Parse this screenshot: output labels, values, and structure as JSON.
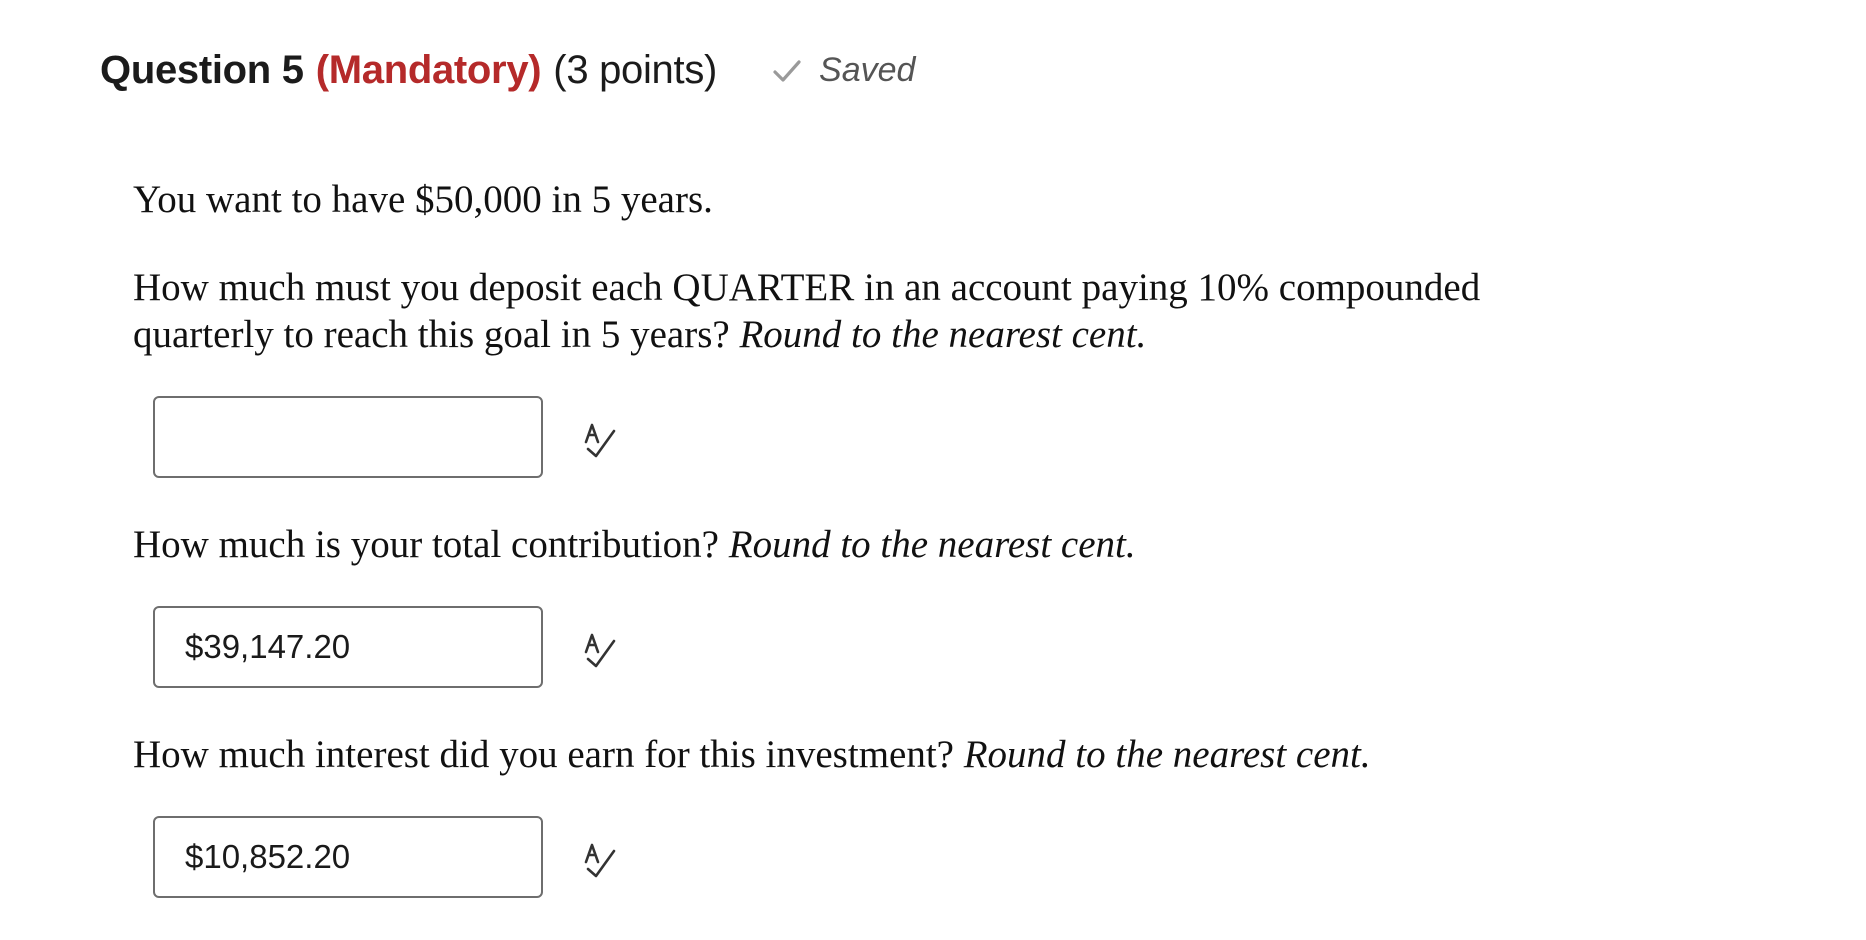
{
  "question": {
    "title": "Question 5",
    "mandatory": "(Mandatory)",
    "points": "(3 points)",
    "saved_label": "Saved",
    "mandatory_color": "#b52a2a",
    "saved_icon": "check-icon"
  },
  "body": {
    "intro": "You want to have $50,000 in 5 years.",
    "q1_line1": "How much must you deposit each QUARTER in an account paying 10% compounded",
    "q1_line2": "quarterly to reach this goal in 5 years?",
    "q1_hint": "Round to the nearest cent.",
    "q2_text": "How much is your total contribution?",
    "q2_hint": "Round to the nearest cent.",
    "q3_text": "How much interest did you earn for this investment?",
    "q3_hint": "Round to the nearest cent."
  },
  "answers": {
    "deposit_value": "",
    "total_contribution_value": "$39,147.20",
    "interest_value": "$10,852.20",
    "spellcheck_icon": "spellcheck-icon"
  }
}
